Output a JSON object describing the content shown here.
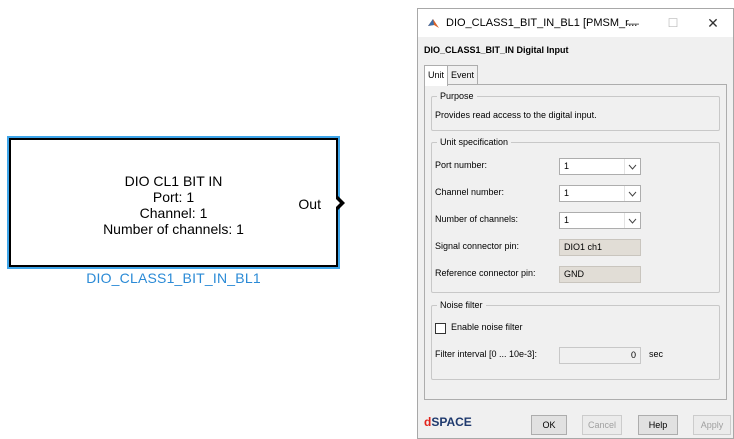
{
  "block": {
    "lines": [
      "DIO CL1 BIT IN",
      "Port: 1",
      "Channel: 1",
      "Number of channels: 1"
    ],
    "out_label": "Out",
    "name": "DIO_CLASS1_BIT_IN_BL1"
  },
  "dialog": {
    "title": "DIO_CLASS1_BIT_IN_BL1  [PMSM_r...",
    "window_buttons": {
      "minimize": "—",
      "maximize": "☐",
      "close": "✕"
    },
    "heading": "DIO_CLASS1_BIT_IN  Digital Input",
    "tabs": [
      {
        "label": "Unit",
        "active": true
      },
      {
        "label": "Event",
        "active": false
      }
    ],
    "purpose": {
      "title": "Purpose",
      "text": "Provides read access to the digital input."
    },
    "unit_spec": {
      "title": "Unit specification",
      "port_number": {
        "label": "Port number:",
        "value": "1"
      },
      "channel_number": {
        "label": "Channel number:",
        "value": "1"
      },
      "number_of_channels": {
        "label": "Number of channels:",
        "value": "1"
      },
      "signal_connector_pin": {
        "label": "Signal connector pin:",
        "value": "DIO1 ch1"
      },
      "reference_connector_pin": {
        "label": "Reference connector pin:",
        "value": "GND"
      }
    },
    "noise_filter": {
      "title": "Noise filter",
      "enable_label": "Enable noise filter",
      "enable_checked": false,
      "interval_label": "Filter interval [0 ... 10e-3]:",
      "interval_value": "0",
      "interval_unit": "sec"
    },
    "footer": {
      "brand_d": "d",
      "brand_rest": "SPACE",
      "ok": "OK",
      "cancel": "Cancel",
      "help": "Help",
      "apply": "Apply"
    }
  },
  "colors": {
    "block_highlight": "#3fa6ea",
    "block_name": "#2a8ad6",
    "readonly_field": "#e1ddd6",
    "brand_red": "#e2231a",
    "brand_blue": "#1f3a6e"
  }
}
